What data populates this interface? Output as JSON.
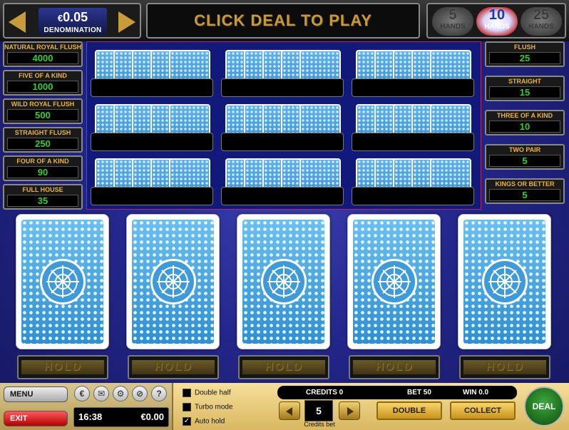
{
  "top": {
    "denomination_value": "0.05",
    "denomination_currency": "€",
    "denomination_label": "DENOMINATION",
    "message": "CLICK DEAL TO PLAY",
    "hands_options": [
      {
        "number": "5",
        "label": "HANDS",
        "active": false
      },
      {
        "number": "10",
        "label": "HANDS",
        "active": true
      },
      {
        "number": "25",
        "label": "HANDS",
        "active": false
      }
    ]
  },
  "paytable_left": [
    {
      "name": "NATURAL ROYAL FLUSH",
      "value": "4000"
    },
    {
      "name": "FIVE OF A KIND",
      "value": "1000"
    },
    {
      "name": "WILD ROYAL FLUSH",
      "value": "500"
    },
    {
      "name": "STRAIGHT FLUSH",
      "value": "250"
    },
    {
      "name": "FOUR OF A KIND",
      "value": "90"
    },
    {
      "name": "FULL HOUSE",
      "value": "35"
    }
  ],
  "paytable_right": [
    {
      "name": "FLUSH",
      "value": "25"
    },
    {
      "name": "STRAIGHT",
      "value": "15"
    },
    {
      "name": "THREE OF A KIND",
      "value": "10"
    },
    {
      "name": "TWO PAIR",
      "value": "5"
    },
    {
      "name": "KINGS OR BETTER",
      "value": "5"
    }
  ],
  "hold_label": "HOLD",
  "bottom": {
    "menu_label": "MENU",
    "exit_label": "EXIT",
    "icons": [
      "euro-icon",
      "mail-icon",
      "settings-icon",
      "sound-off-icon",
      "help-icon"
    ],
    "clock": "16:38",
    "balance": "€0.00",
    "options": [
      {
        "label": "Double half",
        "checked": false
      },
      {
        "label": "Turbo mode",
        "checked": false
      },
      {
        "label": "Auto hold",
        "checked": true
      }
    ],
    "credits": "CREDITS 0",
    "bet": "BET 50",
    "win": "WIN 0.0",
    "credits_bet_value": "5",
    "credits_bet_label": "Credits bet",
    "double_label": "DOUBLE",
    "collect_label": "COLLECT",
    "deal_label": "DEAL"
  }
}
